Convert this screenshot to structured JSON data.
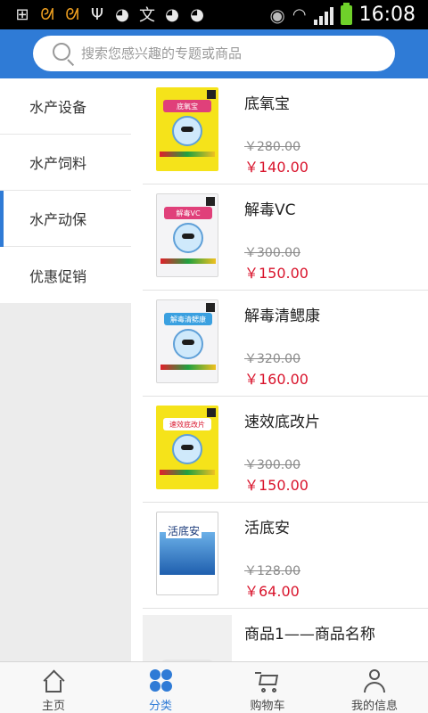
{
  "status_bar": {
    "time": "16:08",
    "left_icons": [
      "add-box-icon",
      "squirrel-icon",
      "squirrel-icon",
      "usb-icon",
      "weibo-icon",
      "alipay-icon",
      "weibo-icon",
      "weibo-icon"
    ],
    "right_icons": [
      "eye-icon",
      "wifi-icon",
      "signal-icon",
      "battery-icon"
    ]
  },
  "header": {
    "search_placeholder": "搜索您感兴趣的专题或商品"
  },
  "sidebar": {
    "items": [
      {
        "label": "水产设备"
      },
      {
        "label": "水产饲料"
      },
      {
        "label": "水产动保"
      },
      {
        "label": "优惠促销"
      }
    ],
    "active_index": 2
  },
  "products": [
    {
      "name": "底氧宝",
      "old_price": "￥280.00",
      "price": "￥140.00",
      "package_text": "底氧宝"
    },
    {
      "name": "解毒VC",
      "old_price": "￥300.00",
      "price": "￥150.00",
      "package_text": "解毒VC"
    },
    {
      "name": "解毒清鳃康",
      "old_price": "￥320.00",
      "price": "￥160.00",
      "package_text": "解毒清鳃康"
    },
    {
      "name": "速效底改片",
      "old_price": "￥300.00",
      "price": "￥150.00",
      "package_text": "速效底改片"
    },
    {
      "name": "活底安",
      "old_price": "￥128.00",
      "price": "￥64.00",
      "package_text": "活底安"
    },
    {
      "name": "商品1——商品名称",
      "old_price": "",
      "price": ""
    }
  ],
  "bottom_nav": [
    {
      "label": "主页",
      "icon": "home-icon"
    },
    {
      "label": "分类",
      "icon": "grid-icon"
    },
    {
      "label": "购物车",
      "icon": "cart-icon"
    },
    {
      "label": "我的信息",
      "icon": "user-icon"
    }
  ],
  "colors": {
    "accent": "#2f7bd6",
    "price": "#d9142c"
  }
}
